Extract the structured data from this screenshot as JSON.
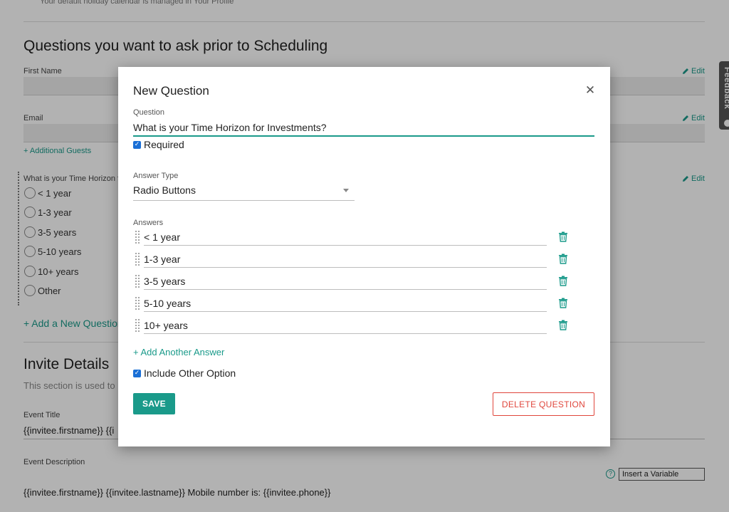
{
  "page": {
    "holiday_note": "Your default holiday calendar is managed in Your Profile",
    "questions_section_title": "Questions you want to ask prior to Scheduling",
    "first_name_label": "First Name",
    "email_label": "Email",
    "edit_label": "Edit",
    "additional_guests": "+ Additional Guests",
    "question_preview_label": "What is your Time Horizon f",
    "preview_options": [
      "< 1 year",
      "1-3 year",
      "3-5 years",
      "5-10 years",
      "10+ years",
      "Other"
    ],
    "add_question": "+ Add a New Question",
    "invite_section_title": "Invite Details",
    "invite_section_desc": "This section is used to",
    "event_title_label": "Event Title",
    "event_title_value": "{{invitee.firstname}} {{i",
    "event_description_label": "Event Description",
    "event_description_value": "{{invitee.firstname}} {{invitee.lastname}} Mobile number is: {{invitee.phone}}",
    "insert_variable": "Insert a Variable",
    "help_icon_glyph": "?",
    "feedback_tab": "Feedback"
  },
  "modal": {
    "title": "New Question",
    "close_glyph": "✕",
    "question_label": "Question",
    "question_value": "What is your Time Horizon for Investments?",
    "required_label": "Required",
    "required_checked": true,
    "answer_type_label": "Answer Type",
    "answer_type_value": "Radio Buttons",
    "answers_label": "Answers",
    "answers": [
      "< 1 year",
      "1-3 year",
      "3-5 years",
      "5-10 years",
      "10+ years"
    ],
    "add_answer": "+ Add Another Answer",
    "include_other_label": "Include Other Option",
    "include_other_checked": true,
    "save_label": "SAVE",
    "delete_label": "DELETE QUESTION",
    "check_glyph": "✓"
  },
  "colors": {
    "accent": "#1a9a8a",
    "danger": "#e0463c",
    "checkbox": "#1a6fd6"
  }
}
